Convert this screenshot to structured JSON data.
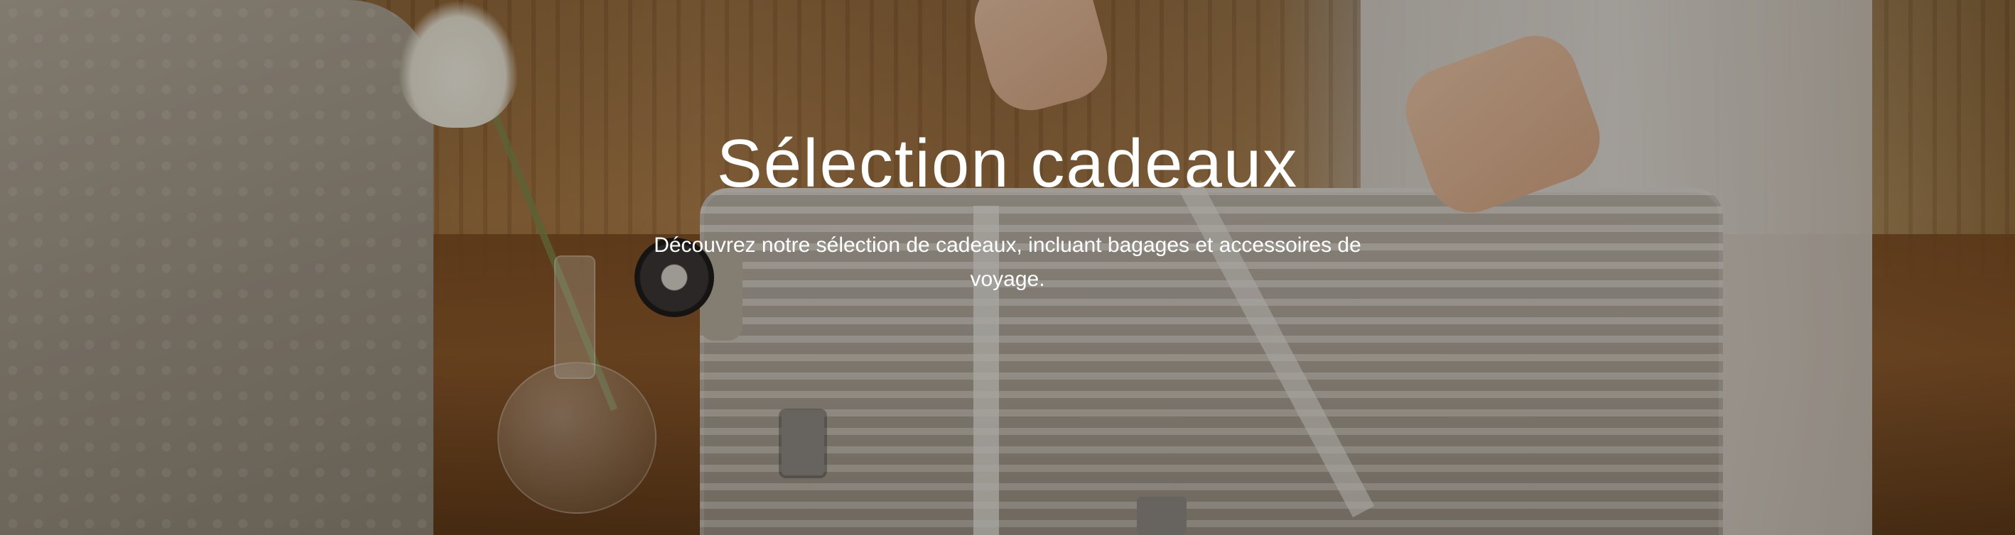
{
  "hero": {
    "title": "Sélection cadeaux",
    "description": "Découvrez notre sélection de cadeaux, incluant bagages et accessoires de voyage.",
    "text_color": "#ffffff",
    "background_image": "hands-tying-ribbon-on-silver-suitcase-photo"
  }
}
